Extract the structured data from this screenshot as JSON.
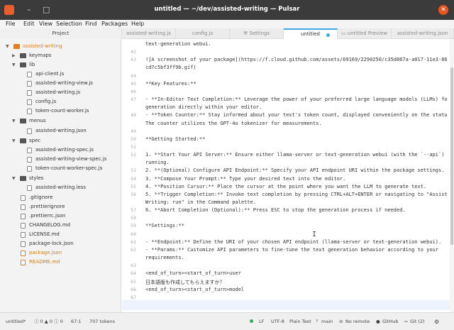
{
  "window": {
    "title": "untitled — ~/dev/assisted-writing — Pulsar",
    "minimize_symbol": "–",
    "maximize_symbol": "□",
    "close_symbol": "✕",
    "accent": "#e95420"
  },
  "menu": [
    "File",
    "Edit",
    "View",
    "Selection",
    "Find",
    "Packages",
    "Help"
  ],
  "tabs": {
    "project": "Project",
    "items": [
      "assisted-writing.js",
      "config.js",
      "⚒ Settings",
      "untitled",
      "▭ untitled Preview",
      "assisted-writing.json"
    ]
  },
  "tree": [
    {
      "label": "assisted-writing",
      "type": "folder",
      "expanded": true
    },
    {
      "label": "keymaps",
      "type": "folder",
      "expanded": false
    },
    {
      "label": "lib",
      "type": "folder",
      "expanded": true
    },
    {
      "label": "api-client.js",
      "type": "file"
    },
    {
      "label": "assisted-writing-view.js",
      "type": "file"
    },
    {
      "label": "assisted-writing.js",
      "type": "file"
    },
    {
      "label": "config.js",
      "type": "file"
    },
    {
      "label": "token-count-worker.js",
      "type": "file"
    },
    {
      "label": "menus",
      "type": "folder",
      "expanded": true
    },
    {
      "label": "assisted-writing.json",
      "type": "file"
    },
    {
      "label": "spec",
      "type": "folder",
      "expanded": true
    },
    {
      "label": "assisted-writing-spec.js",
      "type": "file"
    },
    {
      "label": "assisted-writing-view-spec.js",
      "type": "file"
    },
    {
      "label": "token-count-worker-spec.js",
      "type": "file"
    },
    {
      "label": "styles",
      "type": "folder",
      "expanded": true
    },
    {
      "label": "assisted-writing.less",
      "type": "file"
    },
    {
      "label": ".gitignore",
      "type": "file"
    },
    {
      "label": ".prettierignore",
      "type": "file"
    },
    {
      "label": ".prettierrc.json",
      "type": "file"
    },
    {
      "label": "CHANGELOG.md",
      "type": "file"
    },
    {
      "label": "LICENSE.md",
      "type": "file"
    },
    {
      "label": "package-lock.json",
      "type": "file"
    },
    {
      "label": "package.json",
      "type": "file"
    },
    {
      "label": "README.md",
      "type": "file"
    }
  ],
  "editor": {
    "lines": [
      {
        "num": "",
        "text": "text-generation webui."
      },
      {
        "num": "42",
        "text": ""
      },
      {
        "num": "43",
        "text": "![A screenshot of your package](https://f.cloud.github.com/assets/69169/2290250/c35d867a-a017-11e3-86be-"
      },
      {
        "num": "",
        "text": "cd7c5bf3ff9b.gif)"
      },
      {
        "num": "44",
        "text": ""
      },
      {
        "num": "45",
        "text": "**Key Features:**"
      },
      {
        "num": "46",
        "text": ""
      },
      {
        "num": "47",
        "text": "- **In-Editor Text Completion:** Leverage the power of your preferred large language models (LLMs) for text"
      },
      {
        "num": "",
        "text": "generation directly within your editor."
      },
      {
        "num": "48",
        "text": "- **Token Counter:** Stay informed about your text's token count, displayed conveniently on the statusbar."
      },
      {
        "num": "",
        "text": "The counter utilizes the GPT-4o tokenizer for measurements."
      },
      {
        "num": "49",
        "text": ""
      },
      {
        "num": "50",
        "text": "**Getting Started:**"
      },
      {
        "num": "51",
        "text": ""
      },
      {
        "num": "52",
        "text": "1.  **Start Your API Server:** Ensure either llama-server or text-generation webui (with the `--api`) is"
      },
      {
        "num": "",
        "text": "running."
      },
      {
        "num": "53",
        "text": "2.  **(Optional) Configure API Endpoint:** Specify your API endpoint URI within the package settings."
      },
      {
        "num": "54",
        "text": "3.  **Compose Your Prompt:** Type your desired text into the editor."
      },
      {
        "num": "55",
        "text": "4.  **Position Cursor:** Place the cursor at the point where you want the LLM to generate text."
      },
      {
        "num": "56",
        "text": "5.  **Trigger Completion:** Invoke text completion by pressing CTRL+ALT+ENTER or navigating to \"Assisted"
      },
      {
        "num": "",
        "text": "Writing: run\" in the Command palette."
      },
      {
        "num": "57",
        "text": "6.  **Abort Completion (Optional):** Press ESC to stop the generation process if needed."
      },
      {
        "num": "58",
        "text": ""
      },
      {
        "num": "59",
        "text": "**Settings:**"
      },
      {
        "num": "60",
        "text": ""
      },
      {
        "num": "61",
        "text": "- **Endpoint:** Define the URI of your chosen API endpoint (llama-server or text-generation webui)."
      },
      {
        "num": "62",
        "text": "- **Params:** Customize API parameters to fine-tune the text generation behavior according to your"
      },
      {
        "num": "",
        "text": "requirements."
      },
      {
        "num": "63",
        "text": ""
      },
      {
        "num": "64",
        "text": "<end_of_turn><start_of_turn>user"
      },
      {
        "num": "65",
        "text": "日本語版も作成してもらえますか？"
      },
      {
        "num": "66",
        "text": "<end_of_turn><start_of_turn>model"
      },
      {
        "num": "67",
        "text": ""
      }
    ]
  },
  "status": {
    "file": "untitled*",
    "diagnostics": "ⓘ 0 ▲ 0 ⓘ 0",
    "cursor": "67:1",
    "tokens": "707 tokens",
    "line_ending": "LF",
    "encoding": "UTF-8",
    "grammar": "Plain Text",
    "branch": "main",
    "remote": "No remote",
    "github": "GitHub",
    "git": "Git (2)",
    "status_color": "#36a85a"
  }
}
